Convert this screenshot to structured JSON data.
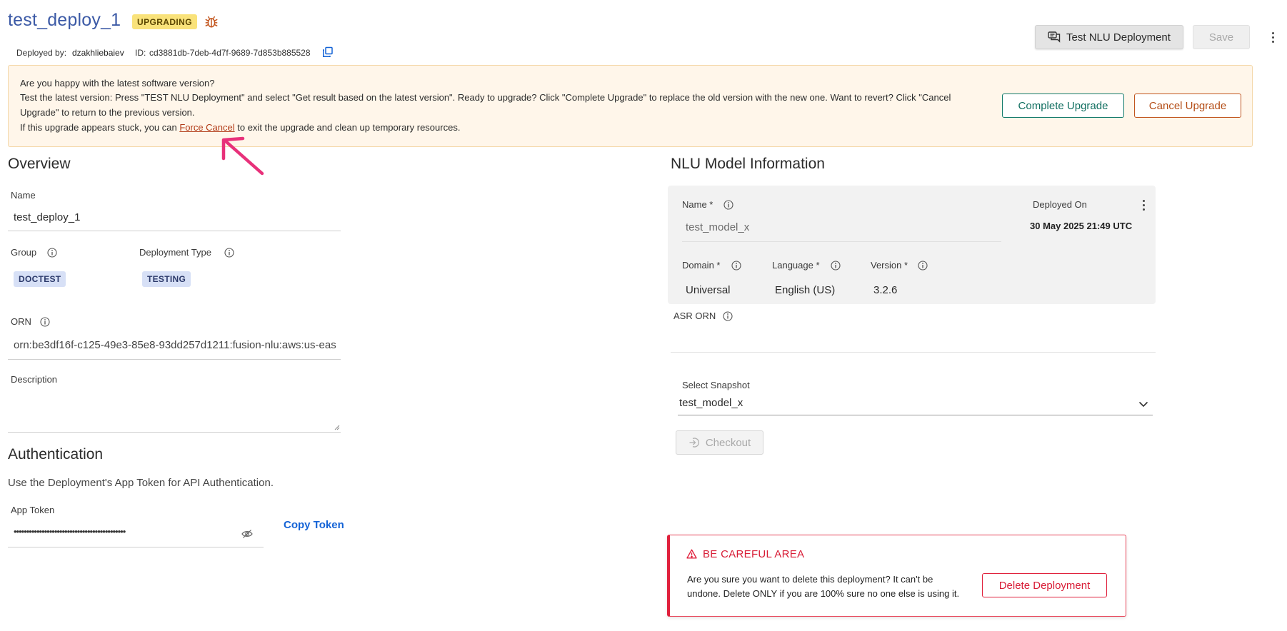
{
  "header": {
    "title": "test_deploy_1",
    "status_badge": "UPGRADING",
    "deployed_by_label": "Deployed by:",
    "deployed_by_value": "dzakhliebaiev",
    "id_label": "ID:",
    "id_value": "cd3881db-7deb-4d7f-9689-7d853b885528",
    "test_button": "Test NLU Deployment",
    "save_button": "Save"
  },
  "banner": {
    "line1": "Are you happy with the latest software version?",
    "line2": "Test the latest version: Press \"TEST NLU Deployment\" and select \"Get result based on the latest version\". Ready to upgrade? Click \"Complete Upgrade\" to replace the old version with the new one. Want to revert? Click \"Cancel",
    "line3": "Upgrade\" to return to the previous version.",
    "line4_prefix": "If this upgrade appears stuck, you can",
    "force_cancel_link": "Force Cancel",
    "line4_suffix": "to exit the upgrade and clean up temporary resources.",
    "complete_button": "Complete Upgrade",
    "cancel_button": "Cancel Upgrade"
  },
  "overview": {
    "heading": "Overview",
    "name_label": "Name",
    "name_value": "test_deploy_1",
    "group_label": "Group",
    "group_value": "DOCTEST",
    "type_label": "Deployment Type",
    "type_value": "TESTING",
    "orn_label": "ORN",
    "orn_value": "orn:be3df16f-c125-49e3-85e8-93dd257d1211:fusion-nlu:aws:us-eas",
    "description_label": "Description"
  },
  "auth": {
    "heading": "Authentication",
    "subtitle": "Use the Deployment's App Token for API Authentication.",
    "token_label": "App Token",
    "token_value": "••••••••••••••••••••••••••••••••••••••••••••",
    "copy_token": "Copy Token"
  },
  "nlu": {
    "heading": "NLU Model Information",
    "name_label": "Name *",
    "name_value": "test_model_x",
    "deployed_on_label": "Deployed On",
    "deployed_on_value": "30 May 2025 21:49 UTC",
    "domain_label": "Domain *",
    "domain_value": "Universal",
    "language_label": "Language *",
    "language_value": "English (US)",
    "version_label": "Version *",
    "version_value": "3.2.6",
    "asr_label": "ASR ORN",
    "snapshot_label": "Select Snapshot",
    "snapshot_value": "test_model_x",
    "checkout_button": "Checkout"
  },
  "danger": {
    "title": "BE CAREFUL AREA",
    "line1": "Are you sure you want to delete this deployment? It can't be",
    "line2": "undone. Delete ONLY if you are 100% sure no one else is using it.",
    "delete_button": "Delete Deployment"
  },
  "colors": {
    "title_blue": "#3c5aa6",
    "badge_yellow": "#f9e27a",
    "banner_bg": "#fff6ea",
    "teal": "#0f6e5f",
    "orange": "#b44d16",
    "danger_red": "#e0203c",
    "link_blue": "#1463d6"
  }
}
